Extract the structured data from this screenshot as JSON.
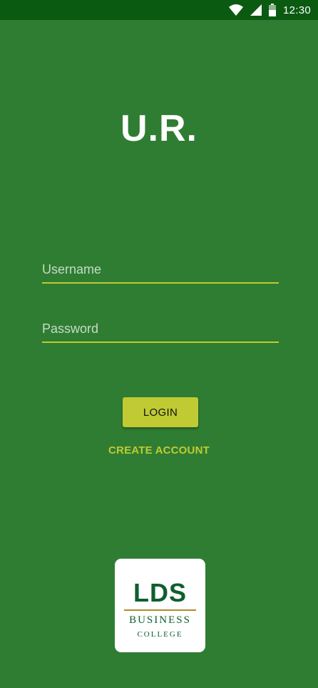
{
  "status_bar": {
    "time": "12:30",
    "icons": [
      "wifi-icon",
      "cell-signal-icon",
      "battery-icon"
    ]
  },
  "app": {
    "title": "U.R."
  },
  "login_form": {
    "username_placeholder": "Username",
    "password_placeholder": "Password",
    "username_value": "",
    "password_value": "",
    "login_label": "LOGIN",
    "create_account_label": "CREATE ACCOUNT"
  },
  "logo": {
    "mark": "LDS",
    "line1": "BUSINESS",
    "line2": "COLLEGE"
  },
  "colors": {
    "background": "#2f7d32",
    "status_bar": "#0b5a12",
    "accent": "#c0ca33",
    "logo_green": "#115e2e"
  }
}
